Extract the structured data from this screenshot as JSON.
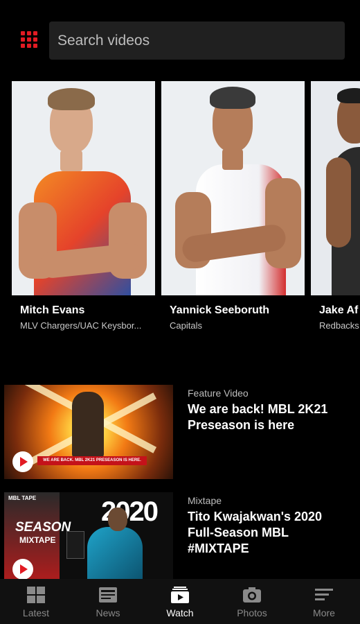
{
  "search": {
    "placeholder": "Search videos"
  },
  "players": [
    {
      "name": "Mitch Evans",
      "team": "MLV Chargers/UAC Keysbor..."
    },
    {
      "name": "Yannick Seeboruth",
      "team": "Capitals"
    },
    {
      "name": "Jake Af",
      "team": "Redbacks"
    }
  ],
  "videos": [
    {
      "category": "Feature Video",
      "title": "We are back! MBL 2K21 Preseason is here"
    },
    {
      "category": "Mixtape",
      "title": "Tito Kwajakwan's 2020 Full-Season MBL #MIXTAPE"
    }
  ],
  "thumbs": {
    "v1_banner": "WE ARE BACK. MBL 2K21 PRESEASON IS HERE.",
    "v2_season": "SEASON",
    "v2_mixtape": "MIXTAPE",
    "v2_year": "2020",
    "v2_brand": "MBL TAPE"
  },
  "nav": {
    "items": [
      {
        "label": "Latest",
        "icon": "grid-icon"
      },
      {
        "label": "News",
        "icon": "newspaper-icon"
      },
      {
        "label": "Watch",
        "icon": "play-stack-icon"
      },
      {
        "label": "Photos",
        "icon": "camera-icon"
      },
      {
        "label": "More",
        "icon": "menu-icon"
      }
    ],
    "active": "Watch"
  },
  "colors": {
    "accent": "#e21b23",
    "background": "#000000",
    "search_bg": "#202020"
  }
}
